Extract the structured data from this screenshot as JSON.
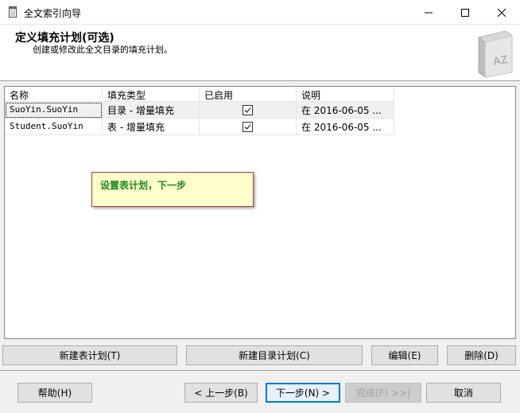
{
  "window": {
    "title": "全文索引向导",
    "minimize_glyph": "—",
    "maximize_glyph": "☐",
    "close_glyph": "✕"
  },
  "header": {
    "title": "定义填充计划(可选)",
    "subtitle": "创建或修改此全文目录的填充计划。"
  },
  "grid": {
    "columns": [
      "名称",
      "填充类型",
      "已启用",
      "说明"
    ],
    "rows": [
      {
        "name": "SuoYin.SuoYin",
        "type": "目录 - 增量填充",
        "enabled": true,
        "desc": "在 2016-06-05 ..."
      },
      {
        "name": "Student.SuoYin",
        "type": "表 - 增量填充",
        "enabled": true,
        "desc": "在 2016-06-05 ..."
      }
    ]
  },
  "callout": {
    "text": "设置表计划，下一步"
  },
  "actions": {
    "new_table_schedule": "新建表计划(T)",
    "new_catalog_schedule": "新建目录计划(C)",
    "edit": "编辑(E)",
    "delete": "删除(D)"
  },
  "footer": {
    "help": "帮助(H)",
    "back": "< 上一步(B)",
    "next": "下一步(N) >",
    "finish": "完成(F) >>|",
    "cancel": "取消"
  },
  "colors": {
    "accent": "#0078d7",
    "callout_bg": "#ffffcc",
    "callout_border": "#b53a3a",
    "callout_text": "#1a8a1a"
  },
  "icons": {
    "app": "document-icon",
    "header_art": "catalog-book-icon",
    "checkbox": "checked-checkbox-icon"
  }
}
